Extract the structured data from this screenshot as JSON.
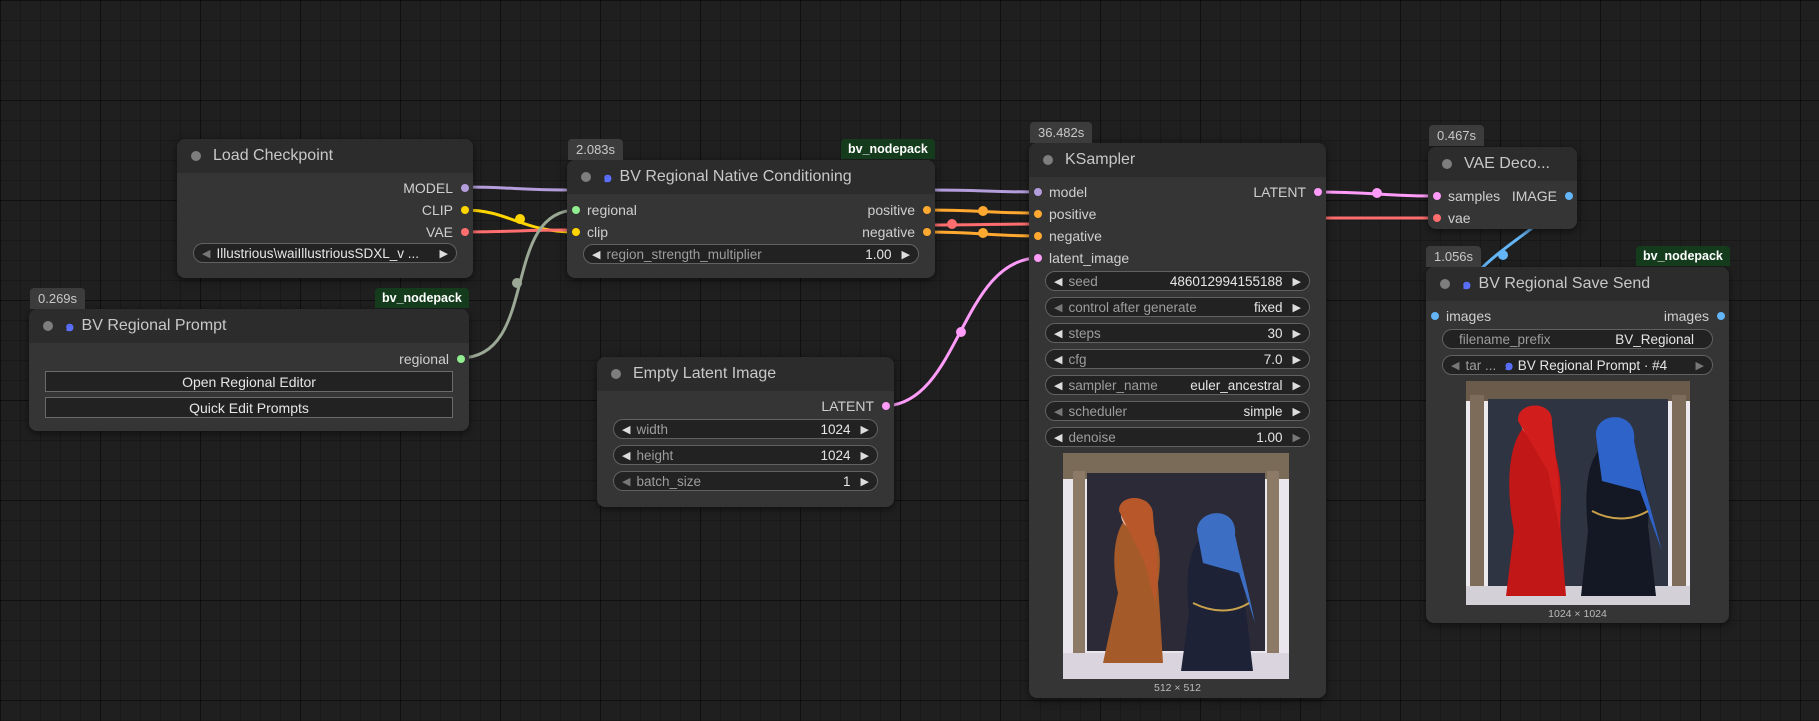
{
  "colors": {
    "model": "#b39ddb",
    "clip": "#ffd500",
    "vae": "#ff6e6e",
    "conditioning": "#ffa931",
    "latent": "#ff9cf9",
    "image": "#64b5f6",
    "regional": "#90ee90",
    "link_regional": "#9aa895"
  },
  "load_checkpoint": {
    "title": "Load Checkpoint",
    "outputs": [
      "MODEL",
      "CLIP",
      "VAE"
    ],
    "ckpt_name": "Illustrious\\waiIllustriousSDXL_v ..."
  },
  "bv_regional_prompt": {
    "time": "0.269s",
    "pack": "bv_nodepack",
    "title": "BV Regional Prompt",
    "output": "regional",
    "button_editor": "Open Regional Editor",
    "button_quick": "Quick Edit Prompts"
  },
  "bv_conditioning": {
    "time": "2.083s",
    "pack": "bv_nodepack",
    "title": "BV Regional Native Conditioning",
    "inputs": [
      "regional",
      "clip"
    ],
    "outputs": [
      "positive",
      "negative"
    ],
    "widget_label": "region_strength_multiplier",
    "widget_value": "1.00"
  },
  "empty_latent": {
    "title": "Empty Latent Image",
    "output": "LATENT",
    "widgets": [
      {
        "label": "width",
        "value": "1024"
      },
      {
        "label": "height",
        "value": "1024"
      },
      {
        "label": "batch_size",
        "value": "1"
      }
    ]
  },
  "ksampler": {
    "time": "36.482s",
    "title": "KSampler",
    "inputs": [
      "model",
      "positive",
      "negative",
      "latent_image"
    ],
    "output": "LATENT",
    "widgets": [
      {
        "label": "seed",
        "value": "486012994155188"
      },
      {
        "label": "control after generate",
        "value": "fixed"
      },
      {
        "label": "steps",
        "value": "30"
      },
      {
        "label": "cfg",
        "value": "7.0"
      },
      {
        "label": "sampler_name",
        "value": "euler_ancestral"
      },
      {
        "label": "scheduler",
        "value": "simple"
      },
      {
        "label": "denoise",
        "value": "1.00"
      }
    ],
    "preview_caption": "512 × 512"
  },
  "vae_decode": {
    "time": "0.467s",
    "title": "VAE Deco...",
    "inputs": [
      "samples",
      "vae"
    ],
    "output": "IMAGE"
  },
  "bv_save_send": {
    "time": "1.056s",
    "pack": "bv_nodepack",
    "title": "BV Regional Save Send",
    "input": "images",
    "output": "images",
    "filename_label": "filename_prefix",
    "filename_value": "BV_Regional",
    "target_label": "tar ...",
    "target_value": "BV Regional Prompt · #4",
    "preview_caption": "1024 × 1024"
  }
}
